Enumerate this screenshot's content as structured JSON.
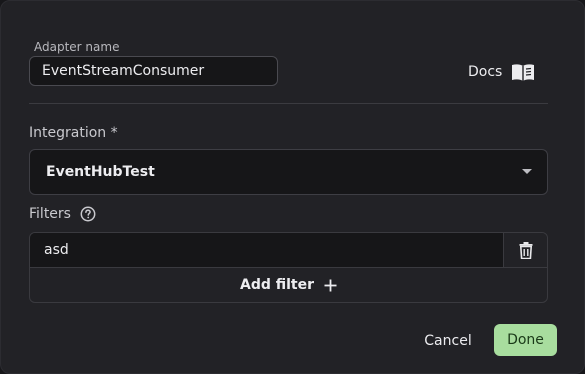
{
  "adapter": {
    "legend": "Adapter name",
    "value": "EventStreamConsumer"
  },
  "docs": {
    "label": "Docs",
    "icon": "book-icon"
  },
  "integration": {
    "label": "Integration *",
    "selected": "EventHubTest",
    "icon": "caret-down-icon"
  },
  "filters": {
    "label": "Filters",
    "help_icon": "help-circle-icon",
    "items": [
      {
        "value": "asd",
        "delete_icon": "trash-icon"
      }
    ],
    "add_label": "Add filter",
    "add_icon": "plus-icon"
  },
  "actions": {
    "cancel": "Cancel",
    "done": "Done"
  },
  "colors": {
    "dialog_bg": "#222226",
    "field_bg": "#161618",
    "done_bg": "#a8dd9e",
    "border": "#3a3a3f"
  }
}
